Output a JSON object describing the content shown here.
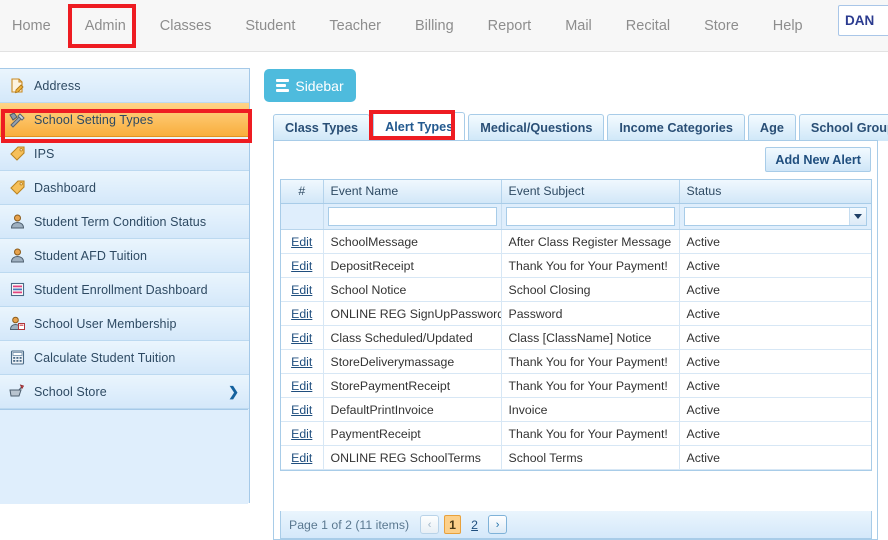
{
  "topnav": {
    "items": [
      {
        "label": "Home"
      },
      {
        "label": "Admin"
      },
      {
        "label": "Classes"
      },
      {
        "label": "Student"
      },
      {
        "label": "Teacher"
      },
      {
        "label": "Billing"
      },
      {
        "label": "Report"
      },
      {
        "label": "Mail"
      },
      {
        "label": "Recital"
      },
      {
        "label": "Store"
      },
      {
        "label": "Help"
      }
    ],
    "user_box_value": "DAN"
  },
  "sidebar": {
    "items": [
      {
        "label": "Address",
        "icon": "document-icon",
        "active": false,
        "has_arrow": false
      },
      {
        "label": "School Setting Types",
        "icon": "tools-icon",
        "active": true,
        "has_arrow": false
      },
      {
        "label": "IPS",
        "icon": "tag-icon",
        "active": false,
        "has_arrow": false
      },
      {
        "label": "Dashboard",
        "icon": "tag-icon",
        "active": false,
        "has_arrow": false
      },
      {
        "label": "Student Term Condition Status",
        "icon": "user-icon",
        "active": false,
        "has_arrow": false
      },
      {
        "label": "Student AFD Tuition",
        "icon": "user-icon",
        "active": false,
        "has_arrow": false
      },
      {
        "label": "Student Enrollment Dashboard",
        "icon": "list-report-icon",
        "active": false,
        "has_arrow": false
      },
      {
        "label": "School User Membership",
        "icon": "user-card-icon",
        "active": false,
        "has_arrow": false
      },
      {
        "label": "Calculate Student Tuition",
        "icon": "calculator-icon",
        "active": false,
        "has_arrow": false
      },
      {
        "label": "School Store",
        "icon": "cart-icon",
        "active": false,
        "has_arrow": true
      }
    ],
    "arrow_glyph": "❯"
  },
  "main": {
    "sidebar_button_label": "Sidebar",
    "tabs": [
      {
        "label": "Class Types",
        "selected": false
      },
      {
        "label": "Alert Types",
        "selected": true
      },
      {
        "label": "Medical/Questions",
        "selected": false
      },
      {
        "label": "Income Categories",
        "selected": false
      },
      {
        "label": "Age",
        "selected": false
      },
      {
        "label": "School Group",
        "selected": false
      }
    ],
    "add_button_label": "Add New Alert",
    "grid": {
      "columns": [
        "#",
        "Event Name",
        "Event Subject",
        "Status"
      ],
      "filters": {
        "event_name": "",
        "event_name_placeholder": "",
        "event_subject": "",
        "event_subject_placeholder": "",
        "status": ""
      },
      "edit_label": "Edit",
      "rows": [
        {
          "event_name": "SchoolMessage",
          "event_subject": "After Class Register Message",
          "status": "Active"
        },
        {
          "event_name": "DepositReceipt",
          "event_subject": "Thank You for Your Payment!",
          "status": "Active"
        },
        {
          "event_name": "School Notice",
          "event_subject": "School Closing",
          "status": "Active"
        },
        {
          "event_name": "ONLINE REG SignUpPassword",
          "event_subject": "Password",
          "status": "Active"
        },
        {
          "event_name": "Class Scheduled/Updated",
          "event_subject": "Class [ClassName] Notice",
          "status": "Active"
        },
        {
          "event_name": "StoreDeliverymassage",
          "event_subject": "Thank You for Your Payment!",
          "status": "Active"
        },
        {
          "event_name": "StorePaymentReceipt",
          "event_subject": "Thank You for Your Payment!",
          "status": "Active"
        },
        {
          "event_name": "DefaultPrintInvoice",
          "event_subject": "Invoice",
          "status": "Active"
        },
        {
          "event_name": "PaymentReceipt",
          "event_subject": "Thank You for Your Payment!",
          "status": "Active"
        },
        {
          "event_name": "ONLINE REG SchoolTerms",
          "event_subject": "School Terms",
          "status": "Active"
        }
      ]
    },
    "pager": {
      "summary": "Page 1 of 2 (11 items)",
      "prev_glyph": "‹",
      "next_glyph": "›",
      "pages": [
        {
          "label": "1",
          "current": true
        },
        {
          "label": "2",
          "current": false
        }
      ]
    }
  },
  "colors": {
    "accent_teal": "#4ebbdd",
    "annotation_red": "#ee1c22",
    "active_orange": "#f9ae3d",
    "panel_blue": "#dfeefc"
  }
}
